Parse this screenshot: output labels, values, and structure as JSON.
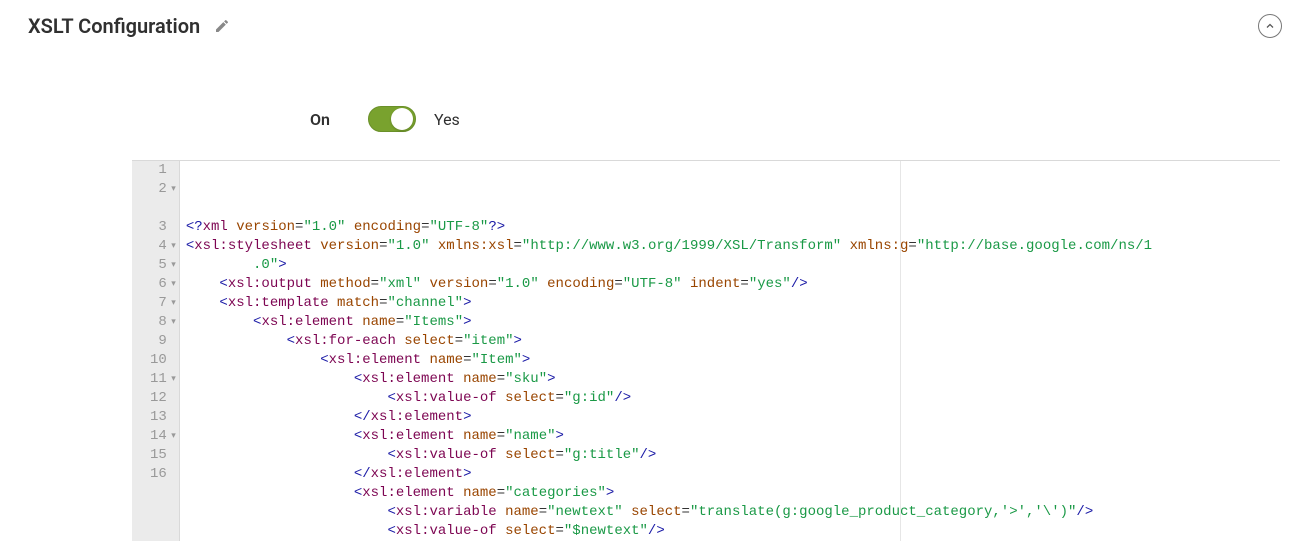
{
  "header": {
    "title": "XSLT Configuration"
  },
  "toggle": {
    "label": "On",
    "value_label": "Yes",
    "enabled": true
  },
  "editor": {
    "lines": [
      {
        "num": "1",
        "foldable": false,
        "indent": 0,
        "tokens": [
          {
            "t": "<?",
            "c": "p-blue"
          },
          {
            "t": "xml ",
            "c": "p-purple"
          },
          {
            "t": "version",
            "c": "p-red"
          },
          {
            "t": "=",
            "c": ""
          },
          {
            "t": "\"1.0\"",
            "c": "p-green"
          },
          {
            "t": " ",
            "c": ""
          },
          {
            "t": "encoding",
            "c": "p-red"
          },
          {
            "t": "=",
            "c": ""
          },
          {
            "t": "\"UTF-8\"",
            "c": "p-green"
          },
          {
            "t": "?>",
            "c": "p-blue"
          }
        ]
      },
      {
        "num": "2",
        "foldable": true,
        "indent": 0,
        "tokens": [
          {
            "t": "<",
            "c": "p-blue"
          },
          {
            "t": "xsl:stylesheet ",
            "c": "p-purple"
          },
          {
            "t": "version",
            "c": "p-red"
          },
          {
            "t": "=",
            "c": ""
          },
          {
            "t": "\"1.0\"",
            "c": "p-green"
          },
          {
            "t": " ",
            "c": ""
          },
          {
            "t": "xmlns:xsl",
            "c": "p-red"
          },
          {
            "t": "=",
            "c": ""
          },
          {
            "t": "\"http://www.w3.org/1999/XSL/Transform\"",
            "c": "p-green"
          },
          {
            "t": " ",
            "c": ""
          },
          {
            "t": "xmlns:g",
            "c": "p-red"
          },
          {
            "t": "=",
            "c": ""
          },
          {
            "t": "\"http://base.google.com/ns/1",
            "c": "p-green"
          }
        ]
      },
      {
        "num": "",
        "foldable": false,
        "indent": 1,
        "tokens": [
          {
            "t": "    .0\"",
            "c": "p-green"
          },
          {
            "t": ">",
            "c": "p-blue"
          }
        ]
      },
      {
        "num": "3",
        "foldable": false,
        "indent": 1,
        "tokens": [
          {
            "t": "<",
            "c": "p-blue"
          },
          {
            "t": "xsl:output ",
            "c": "p-purple"
          },
          {
            "t": "method",
            "c": "p-red"
          },
          {
            "t": "=",
            "c": ""
          },
          {
            "t": "\"xml\"",
            "c": "p-green"
          },
          {
            "t": " ",
            "c": ""
          },
          {
            "t": "version",
            "c": "p-red"
          },
          {
            "t": "=",
            "c": ""
          },
          {
            "t": "\"1.0\"",
            "c": "p-green"
          },
          {
            "t": " ",
            "c": ""
          },
          {
            "t": "encoding",
            "c": "p-red"
          },
          {
            "t": "=",
            "c": ""
          },
          {
            "t": "\"UTF-8\"",
            "c": "p-green"
          },
          {
            "t": " ",
            "c": ""
          },
          {
            "t": "indent",
            "c": "p-red"
          },
          {
            "t": "=",
            "c": ""
          },
          {
            "t": "\"yes\"",
            "c": "p-green"
          },
          {
            "t": "/>",
            "c": "p-blue"
          }
        ]
      },
      {
        "num": "4",
        "foldable": true,
        "indent": 1,
        "tokens": [
          {
            "t": "<",
            "c": "p-blue"
          },
          {
            "t": "xsl:template ",
            "c": "p-purple"
          },
          {
            "t": "match",
            "c": "p-red"
          },
          {
            "t": "=",
            "c": ""
          },
          {
            "t": "\"channel\"",
            "c": "p-green"
          },
          {
            "t": ">",
            "c": "p-blue"
          }
        ]
      },
      {
        "num": "5",
        "foldable": true,
        "indent": 2,
        "tokens": [
          {
            "t": "<",
            "c": "p-blue"
          },
          {
            "t": "xsl:element ",
            "c": "p-purple"
          },
          {
            "t": "name",
            "c": "p-red"
          },
          {
            "t": "=",
            "c": ""
          },
          {
            "t": "\"Items\"",
            "c": "p-green"
          },
          {
            "t": ">",
            "c": "p-blue"
          }
        ]
      },
      {
        "num": "6",
        "foldable": true,
        "indent": 3,
        "tokens": [
          {
            "t": "<",
            "c": "p-blue"
          },
          {
            "t": "xsl:for-each ",
            "c": "p-purple"
          },
          {
            "t": "select",
            "c": "p-red"
          },
          {
            "t": "=",
            "c": ""
          },
          {
            "t": "\"item\"",
            "c": "p-green"
          },
          {
            "t": ">",
            "c": "p-blue"
          }
        ]
      },
      {
        "num": "7",
        "foldable": true,
        "indent": 4,
        "tokens": [
          {
            "t": "<",
            "c": "p-blue"
          },
          {
            "t": "xsl:element ",
            "c": "p-purple"
          },
          {
            "t": "name",
            "c": "p-red"
          },
          {
            "t": "=",
            "c": ""
          },
          {
            "t": "\"Item\"",
            "c": "p-green"
          },
          {
            "t": ">",
            "c": "p-blue"
          }
        ]
      },
      {
        "num": "8",
        "foldable": true,
        "indent": 5,
        "tokens": [
          {
            "t": "<",
            "c": "p-blue"
          },
          {
            "t": "xsl:element ",
            "c": "p-purple"
          },
          {
            "t": "name",
            "c": "p-red"
          },
          {
            "t": "=",
            "c": ""
          },
          {
            "t": "\"sku\"",
            "c": "p-green"
          },
          {
            "t": ">",
            "c": "p-blue"
          }
        ]
      },
      {
        "num": "9",
        "foldable": false,
        "indent": 6,
        "tokens": [
          {
            "t": "<",
            "c": "p-blue"
          },
          {
            "t": "xsl:value-of ",
            "c": "p-purple"
          },
          {
            "t": "select",
            "c": "p-red"
          },
          {
            "t": "=",
            "c": ""
          },
          {
            "t": "\"g:id\"",
            "c": "p-green"
          },
          {
            "t": "/>",
            "c": "p-blue"
          }
        ]
      },
      {
        "num": "10",
        "foldable": false,
        "indent": 5,
        "tokens": [
          {
            "t": "</",
            "c": "p-blue"
          },
          {
            "t": "xsl:element",
            "c": "p-purple"
          },
          {
            "t": ">",
            "c": "p-blue"
          }
        ]
      },
      {
        "num": "11",
        "foldable": true,
        "indent": 5,
        "tokens": [
          {
            "t": "<",
            "c": "p-blue"
          },
          {
            "t": "xsl:element ",
            "c": "p-purple"
          },
          {
            "t": "name",
            "c": "p-red"
          },
          {
            "t": "=",
            "c": ""
          },
          {
            "t": "\"name\"",
            "c": "p-green"
          },
          {
            "t": ">",
            "c": "p-blue"
          }
        ]
      },
      {
        "num": "12",
        "foldable": false,
        "indent": 6,
        "tokens": [
          {
            "t": "<",
            "c": "p-blue"
          },
          {
            "t": "xsl:value-of ",
            "c": "p-purple"
          },
          {
            "t": "select",
            "c": "p-red"
          },
          {
            "t": "=",
            "c": ""
          },
          {
            "t": "\"g:title\"",
            "c": "p-green"
          },
          {
            "t": "/>",
            "c": "p-blue"
          }
        ]
      },
      {
        "num": "13",
        "foldable": false,
        "indent": 5,
        "tokens": [
          {
            "t": "</",
            "c": "p-blue"
          },
          {
            "t": "xsl:element",
            "c": "p-purple"
          },
          {
            "t": ">",
            "c": "p-blue"
          }
        ]
      },
      {
        "num": "14",
        "foldable": true,
        "indent": 5,
        "tokens": [
          {
            "t": "<",
            "c": "p-blue"
          },
          {
            "t": "xsl:element ",
            "c": "p-purple"
          },
          {
            "t": "name",
            "c": "p-red"
          },
          {
            "t": "=",
            "c": ""
          },
          {
            "t": "\"categories\"",
            "c": "p-green"
          },
          {
            "t": ">",
            "c": "p-blue"
          }
        ]
      },
      {
        "num": "15",
        "foldable": false,
        "indent": 6,
        "tokens": [
          {
            "t": "<",
            "c": "p-blue"
          },
          {
            "t": "xsl:variable ",
            "c": "p-purple"
          },
          {
            "t": "name",
            "c": "p-red"
          },
          {
            "t": "=",
            "c": ""
          },
          {
            "t": "\"newtext\"",
            "c": "p-green"
          },
          {
            "t": " ",
            "c": ""
          },
          {
            "t": "select",
            "c": "p-red"
          },
          {
            "t": "=",
            "c": ""
          },
          {
            "t": "\"translate(g:google_product_category,'>','\\')\"",
            "c": "p-green"
          },
          {
            "t": "/>",
            "c": "p-blue"
          }
        ]
      },
      {
        "num": "16",
        "foldable": false,
        "indent": 6,
        "tokens": [
          {
            "t": "<",
            "c": "p-blue"
          },
          {
            "t": "xsl:value-of ",
            "c": "p-purple"
          },
          {
            "t": "select",
            "c": "p-red"
          },
          {
            "t": "=",
            "c": ""
          },
          {
            "t": "\"$newtext\"",
            "c": "p-green"
          },
          {
            "t": "/>",
            "c": "p-blue"
          }
        ]
      }
    ]
  }
}
